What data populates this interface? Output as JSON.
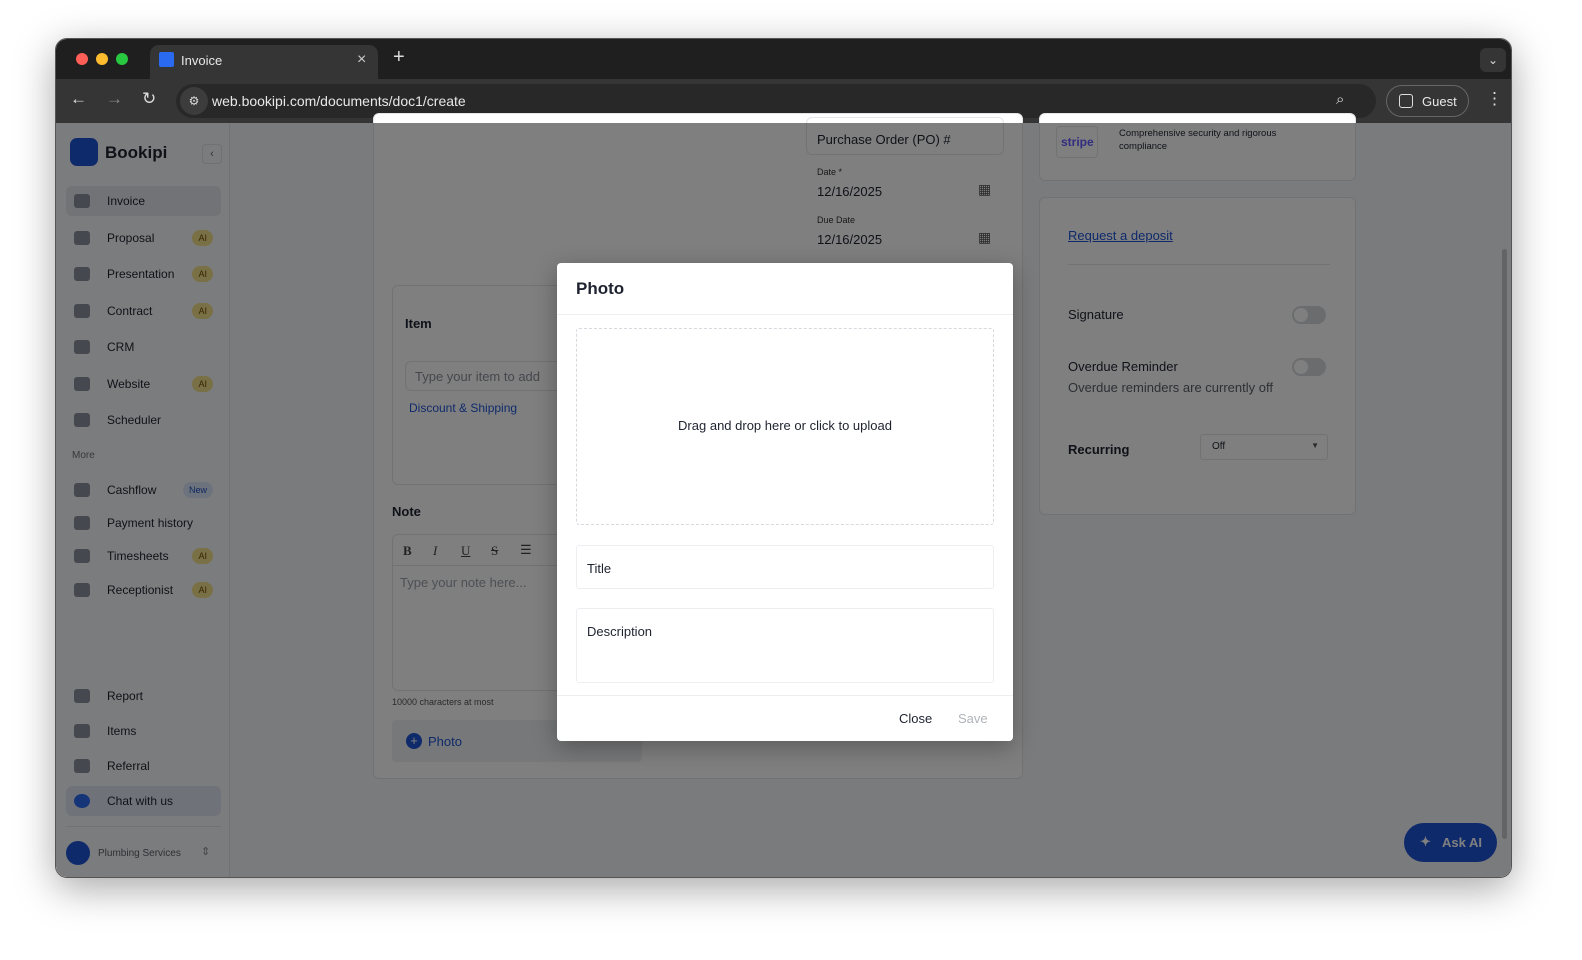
{
  "browser": {
    "tab_title": "Invoice",
    "url": "web.bookipi.com/documents/doc1/create",
    "profile": "Guest"
  },
  "sidebar": {
    "brand": "Bookipi",
    "items": [
      {
        "label": "Invoice"
      },
      {
        "label": "Proposal",
        "badge": "AI"
      },
      {
        "label": "Presentation",
        "badge": "AI"
      },
      {
        "label": "Contract",
        "badge": "AI"
      },
      {
        "label": "CRM"
      },
      {
        "label": "Website",
        "badge": "AI"
      },
      {
        "label": "Scheduler"
      }
    ],
    "more_label": "More",
    "more_items": [
      {
        "label": "Cashflow",
        "badge": "New"
      },
      {
        "label": "Payment history"
      },
      {
        "label": "Timesheets",
        "badge": "AI"
      },
      {
        "label": "Receptionist",
        "badge": "AI"
      }
    ],
    "bottom_items": [
      {
        "label": "Report"
      },
      {
        "label": "Items"
      },
      {
        "label": "Referral"
      },
      {
        "label": "Chat with us"
      }
    ],
    "business": "Plumbing Services"
  },
  "document": {
    "po_placeholder": "Purchase Order (PO) #",
    "date_label": "Date *",
    "date": "12/16/2025",
    "due_label": "Due Date",
    "due_date": "12/16/2025",
    "item_header": "Item",
    "item_placeholder": "Type your item to add",
    "discount_link": "Discount & Shipping",
    "note_header": "Note",
    "note_placeholder": "Type your note here...",
    "note_limit": "10000 characters at most",
    "photo_button": "Photo"
  },
  "settings": {
    "stripe_logo": "stripe",
    "stripe_text": "Comprehensive security and rigorous compliance",
    "deposit_link": "Request a deposit",
    "signature_label": "Signature",
    "signature_on": false,
    "overdue_label": "Overdue Reminder",
    "overdue_on": false,
    "overdue_sub": "Overdue reminders are currently off",
    "recurring_label": "Recurring",
    "recurring_value": "Off"
  },
  "ask_ai": "Ask AI",
  "modal": {
    "title": "Photo",
    "dropzone": "Drag and drop here or click to upload",
    "title_placeholder": "Title",
    "description_placeholder": "Description",
    "close": "Close",
    "save": "Save"
  }
}
